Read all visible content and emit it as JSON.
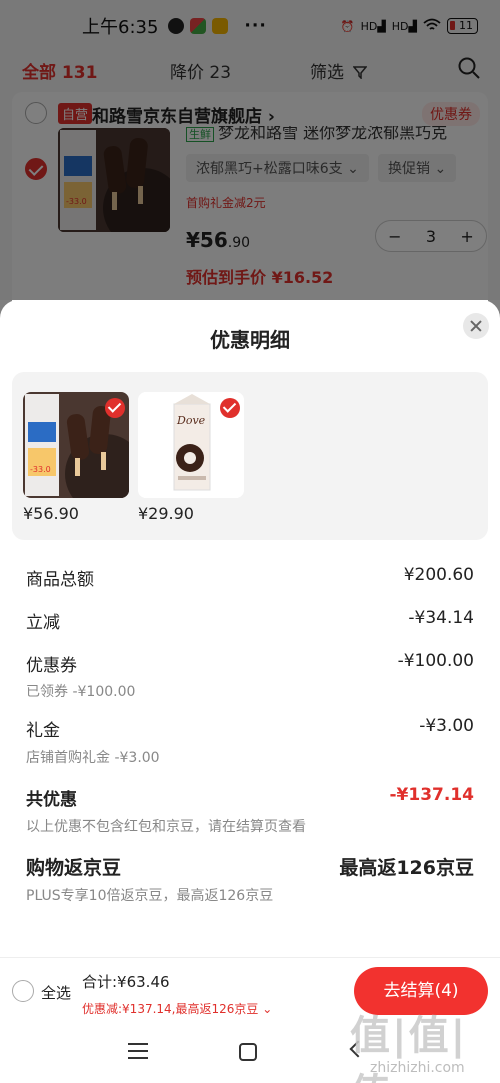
{
  "status_bar": {
    "time": "上午6:35",
    "more": "···",
    "battery": "11",
    "signal_1": "HD",
    "signal_2": "HD"
  },
  "filter_bar": {
    "all_label": "全部 131",
    "price_drop_label": "降价 23",
    "filter_label": "筛选"
  },
  "cart": {
    "self_tag": "自营",
    "shop_name": "和路雪京东自营旗舰店 ›",
    "coupon_pill": "优惠券",
    "fresh_tag": "生鲜",
    "product_title": "梦龙和路雪 迷你梦龙浓郁黑巧克",
    "variant": "浓郁黑巧+松露口味6支 ⌄",
    "promo_button": "换促销 ⌄",
    "gift_note": "首购礼金减2元",
    "price_main": "¥56",
    "price_decimal": ".90",
    "quantity": "3",
    "estimated_price": "预估到手价 ¥16.52"
  },
  "sheet": {
    "title": "优惠明细",
    "items": [
      {
        "price": "¥56.90"
      },
      {
        "price": "¥29.90"
      }
    ],
    "rows": {
      "subtotal_label": "商品总额",
      "subtotal_value": "¥200.60",
      "instant_label": "立减",
      "instant_value": "-¥34.14",
      "coupon_label": "优惠券",
      "coupon_value": "-¥100.00",
      "coupon_sub": "已领券 -¥100.00",
      "gift_label": "礼金",
      "gift_value": "-¥3.00",
      "gift_sub": "店铺首购礼金 -¥3.00",
      "total_discount_label": "共优惠",
      "total_discount_value": "-¥137.14",
      "total_discount_note": "以上优惠不包含红包和京豆，请在结算页查看",
      "beans_label": "购物返京豆",
      "beans_value": "最高返126京豆",
      "beans_note": "PLUS专享10倍返京豆，最高返126京豆"
    }
  },
  "bottom_bar": {
    "select_all": "全选",
    "total": "合计:¥63.46",
    "discount_summary": "优惠减:¥137.14,最高返126京豆 ⌄",
    "checkout": "去结算(4)"
  },
  "watermark": {
    "logo": "值|值|值",
    "site": "zhizhizhi.com"
  },
  "colors": {
    "accent": "#e0302c",
    "checkout": "#f2322f"
  }
}
